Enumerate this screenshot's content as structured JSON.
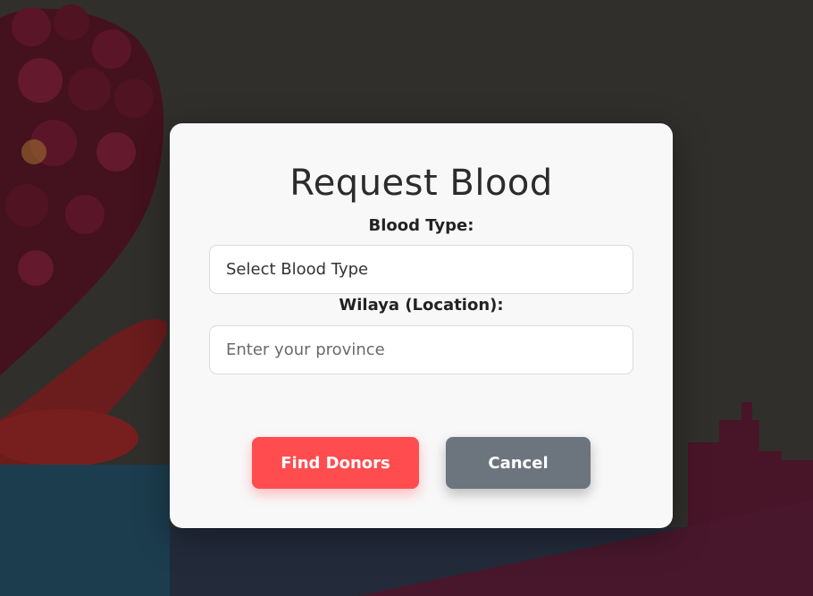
{
  "modal": {
    "title": "Request Blood",
    "blood_type_label": "Blood Type:",
    "blood_type_value": "Select Blood Type",
    "location_label": "Wilaya (Location):",
    "location_placeholder": "Enter your province",
    "find_button_label": "Find Donors",
    "cancel_button_label": "Cancel"
  },
  "colors": {
    "primary": "#ff4d4f",
    "secondary": "#6c757d",
    "modal_bg": "#f8f8f8"
  }
}
